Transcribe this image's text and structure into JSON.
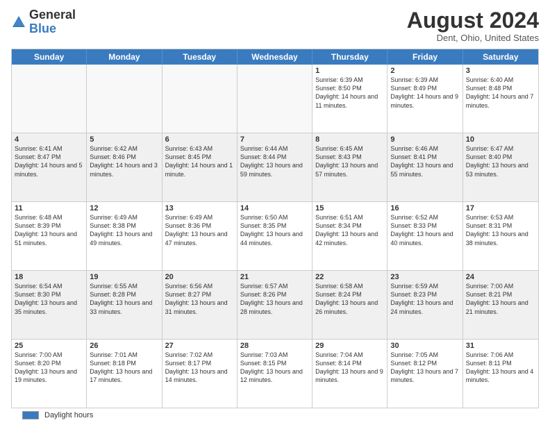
{
  "header": {
    "logo_general": "General",
    "logo_blue": "Blue",
    "month_title": "August 2024",
    "location": "Dent, Ohio, United States"
  },
  "calendar": {
    "days_of_week": [
      "Sunday",
      "Monday",
      "Tuesday",
      "Wednesday",
      "Thursday",
      "Friday",
      "Saturday"
    ],
    "rows": [
      [
        {
          "num": "",
          "info": "",
          "empty": true
        },
        {
          "num": "",
          "info": "",
          "empty": true
        },
        {
          "num": "",
          "info": "",
          "empty": true
        },
        {
          "num": "",
          "info": "",
          "empty": true
        },
        {
          "num": "1",
          "info": "Sunrise: 6:39 AM\nSunset: 8:50 PM\nDaylight: 14 hours\nand 11 minutes."
        },
        {
          "num": "2",
          "info": "Sunrise: 6:39 AM\nSunset: 8:49 PM\nDaylight: 14 hours\nand 9 minutes."
        },
        {
          "num": "3",
          "info": "Sunrise: 6:40 AM\nSunset: 8:48 PM\nDaylight: 14 hours\nand 7 minutes."
        }
      ],
      [
        {
          "num": "4",
          "info": "Sunrise: 6:41 AM\nSunset: 8:47 PM\nDaylight: 14 hours\nand 5 minutes."
        },
        {
          "num": "5",
          "info": "Sunrise: 6:42 AM\nSunset: 8:46 PM\nDaylight: 14 hours\nand 3 minutes."
        },
        {
          "num": "6",
          "info": "Sunrise: 6:43 AM\nSunset: 8:45 PM\nDaylight: 14 hours\nand 1 minute."
        },
        {
          "num": "7",
          "info": "Sunrise: 6:44 AM\nSunset: 8:44 PM\nDaylight: 13 hours\nand 59 minutes."
        },
        {
          "num": "8",
          "info": "Sunrise: 6:45 AM\nSunset: 8:43 PM\nDaylight: 13 hours\nand 57 minutes."
        },
        {
          "num": "9",
          "info": "Sunrise: 6:46 AM\nSunset: 8:41 PM\nDaylight: 13 hours\nand 55 minutes."
        },
        {
          "num": "10",
          "info": "Sunrise: 6:47 AM\nSunset: 8:40 PM\nDaylight: 13 hours\nand 53 minutes."
        }
      ],
      [
        {
          "num": "11",
          "info": "Sunrise: 6:48 AM\nSunset: 8:39 PM\nDaylight: 13 hours\nand 51 minutes."
        },
        {
          "num": "12",
          "info": "Sunrise: 6:49 AM\nSunset: 8:38 PM\nDaylight: 13 hours\nand 49 minutes."
        },
        {
          "num": "13",
          "info": "Sunrise: 6:49 AM\nSunset: 8:36 PM\nDaylight: 13 hours\nand 47 minutes."
        },
        {
          "num": "14",
          "info": "Sunrise: 6:50 AM\nSunset: 8:35 PM\nDaylight: 13 hours\nand 44 minutes."
        },
        {
          "num": "15",
          "info": "Sunrise: 6:51 AM\nSunset: 8:34 PM\nDaylight: 13 hours\nand 42 minutes."
        },
        {
          "num": "16",
          "info": "Sunrise: 6:52 AM\nSunset: 8:33 PM\nDaylight: 13 hours\nand 40 minutes."
        },
        {
          "num": "17",
          "info": "Sunrise: 6:53 AM\nSunset: 8:31 PM\nDaylight: 13 hours\nand 38 minutes."
        }
      ],
      [
        {
          "num": "18",
          "info": "Sunrise: 6:54 AM\nSunset: 8:30 PM\nDaylight: 13 hours\nand 35 minutes."
        },
        {
          "num": "19",
          "info": "Sunrise: 6:55 AM\nSunset: 8:28 PM\nDaylight: 13 hours\nand 33 minutes."
        },
        {
          "num": "20",
          "info": "Sunrise: 6:56 AM\nSunset: 8:27 PM\nDaylight: 13 hours\nand 31 minutes."
        },
        {
          "num": "21",
          "info": "Sunrise: 6:57 AM\nSunset: 8:26 PM\nDaylight: 13 hours\nand 28 minutes."
        },
        {
          "num": "22",
          "info": "Sunrise: 6:58 AM\nSunset: 8:24 PM\nDaylight: 13 hours\nand 26 minutes."
        },
        {
          "num": "23",
          "info": "Sunrise: 6:59 AM\nSunset: 8:23 PM\nDaylight: 13 hours\nand 24 minutes."
        },
        {
          "num": "24",
          "info": "Sunrise: 7:00 AM\nSunset: 8:21 PM\nDaylight: 13 hours\nand 21 minutes."
        }
      ],
      [
        {
          "num": "25",
          "info": "Sunrise: 7:00 AM\nSunset: 8:20 PM\nDaylight: 13 hours\nand 19 minutes."
        },
        {
          "num": "26",
          "info": "Sunrise: 7:01 AM\nSunset: 8:18 PM\nDaylight: 13 hours\nand 17 minutes."
        },
        {
          "num": "27",
          "info": "Sunrise: 7:02 AM\nSunset: 8:17 PM\nDaylight: 13 hours\nand 14 minutes."
        },
        {
          "num": "28",
          "info": "Sunrise: 7:03 AM\nSunset: 8:15 PM\nDaylight: 13 hours\nand 12 minutes."
        },
        {
          "num": "29",
          "info": "Sunrise: 7:04 AM\nSunset: 8:14 PM\nDaylight: 13 hours\nand 9 minutes."
        },
        {
          "num": "30",
          "info": "Sunrise: 7:05 AM\nSunset: 8:12 PM\nDaylight: 13 hours\nand 7 minutes."
        },
        {
          "num": "31",
          "info": "Sunrise: 7:06 AM\nSunset: 8:11 PM\nDaylight: 13 hours\nand 4 minutes."
        }
      ]
    ]
  },
  "footer": {
    "legend_label": "Daylight hours"
  }
}
